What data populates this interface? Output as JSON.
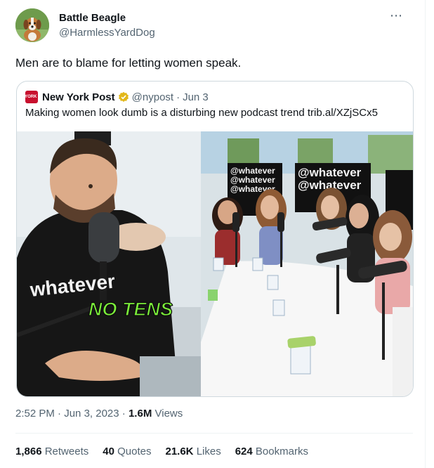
{
  "author": {
    "name": "Battle Beagle",
    "handle": "@HarmlessYardDog"
  },
  "more_icon": "more-dots-icon",
  "tweet_text": "Men are to blame for letting women speak.",
  "quote": {
    "logo_text": "NEW YORK POST",
    "name": "New York Post",
    "handle": "@nypost",
    "separator": "·",
    "date": "Jun 3",
    "text": "Making women look dumb is a disturbing new podcast trend trib.al/XZjSCx5",
    "media": {
      "caption": "NO TENS",
      "hoodie_text": "whatever",
      "sign_text": "@whatever"
    }
  },
  "meta": {
    "time": "2:52 PM",
    "separator": "·",
    "date": "Jun 3, 2023",
    "views_count": "1.6M",
    "views_label": "Views"
  },
  "stats": {
    "retweets_count": "1,866",
    "retweets_label": "Retweets",
    "quotes_count": "40",
    "quotes_label": "Quotes",
    "likes_count": "21.6K",
    "likes_label": "Likes",
    "bookmarks_count": "624",
    "bookmarks_label": "Bookmarks"
  },
  "colors": {
    "text": "#0f1419",
    "secondary": "#536471",
    "border": "#cfd9de",
    "gold_badge": "#e2b719",
    "post_red": "#c8102e",
    "caption_green": "#7cf03a"
  }
}
